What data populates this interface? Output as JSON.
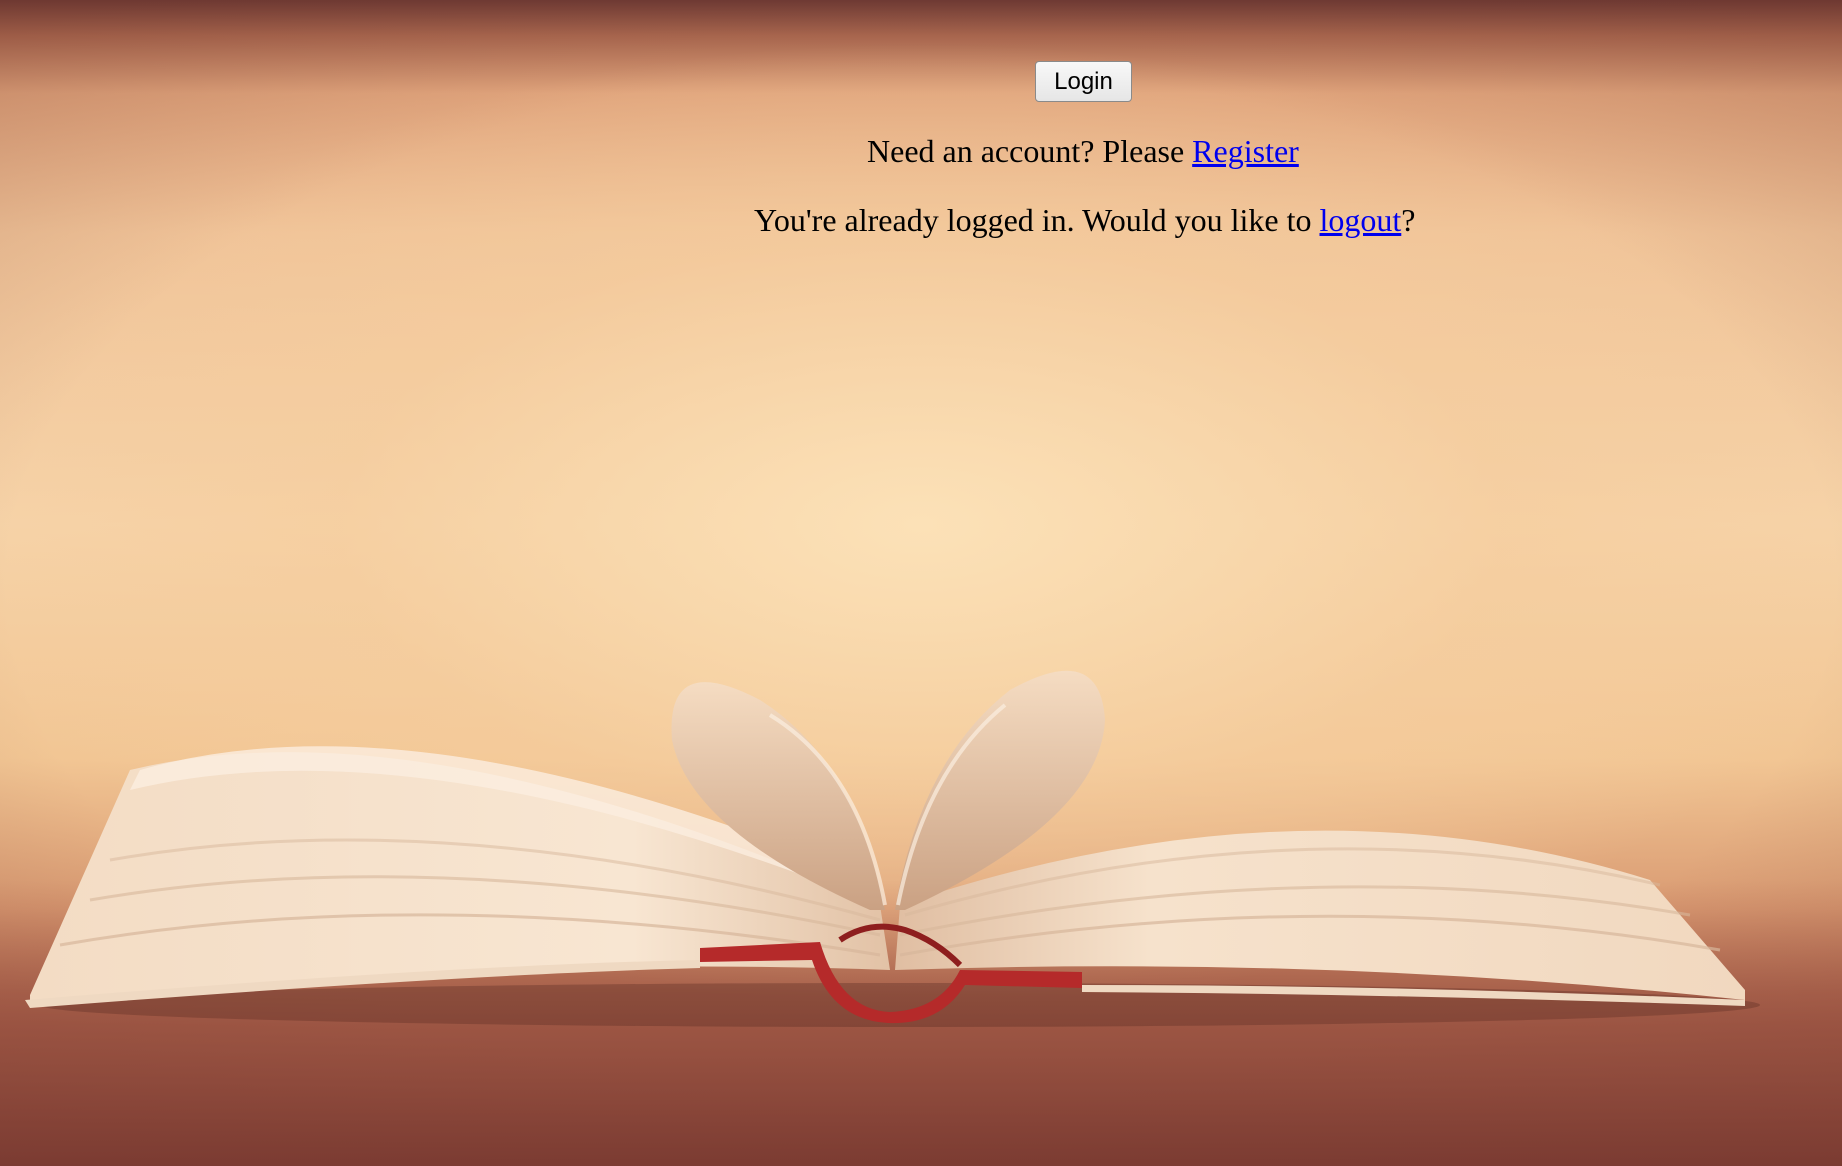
{
  "login_button": {
    "label": "Login"
  },
  "register_line": {
    "prefix": "Need an account? Please ",
    "link_text": "Register"
  },
  "logout_line": {
    "prefix": "You're already logged in. Would you like to ",
    "link_text": "logout",
    "suffix": "?"
  },
  "background": {
    "image": "open-book-heart-pages",
    "colors": {
      "wall": "#f6d3a8",
      "table": "#8a4a3c",
      "cover": "#b52a2a"
    }
  }
}
